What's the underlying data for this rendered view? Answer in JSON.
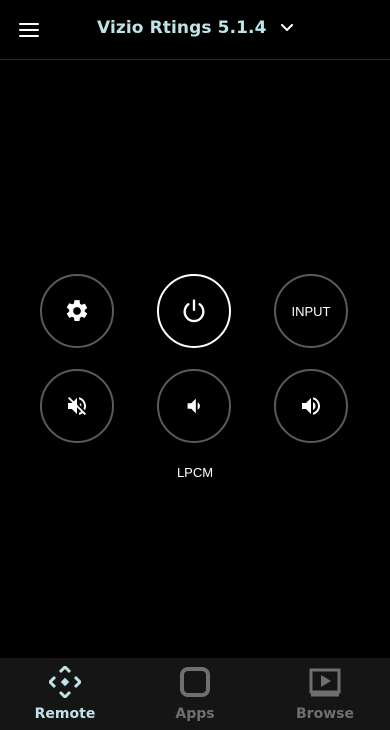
{
  "header": {
    "title": "Vizio Rtings 5.1.4",
    "menu_icon": "hamburger-menu-icon",
    "dropdown_icon": "chevron-down-icon"
  },
  "remote": {
    "buttons": [
      {
        "name": "settings",
        "icon": "gear-icon"
      },
      {
        "name": "power",
        "icon": "power-icon"
      },
      {
        "name": "input",
        "label": "INPUT"
      },
      {
        "name": "mute",
        "icon": "mute-icon"
      },
      {
        "name": "volume-down",
        "icon": "volume-down-icon"
      },
      {
        "name": "volume-up",
        "icon": "volume-up-icon"
      }
    ],
    "audio_format": "LPCM"
  },
  "bottom_nav": {
    "items": [
      {
        "label": "Remote",
        "icon": "dpad-icon",
        "active": true
      },
      {
        "label": "Apps",
        "icon": "apps-square-icon",
        "active": false
      },
      {
        "label": "Browse",
        "icon": "play-screen-icon",
        "active": false
      }
    ]
  },
  "colors": {
    "background": "#000000",
    "accent": "#bfe3e6",
    "inactive": "#6f6f6f",
    "nav_background": "#151515",
    "button_border": "#5a5a5a"
  }
}
